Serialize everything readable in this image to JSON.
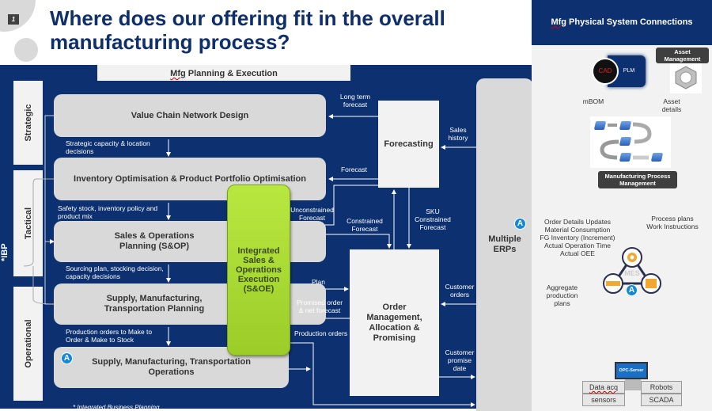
{
  "slide": {
    "number": "1",
    "title": "Where does our offering fit in the overall manufacturing process?"
  },
  "planning_panel": {
    "header_prefix": "Mfg",
    "header_rest": " Planning & Execution",
    "levels": {
      "strategic": "Strategic",
      "tactical": "Tactical",
      "operational": "Operational"
    },
    "ibp_label": "*IBP",
    "boxes": {
      "value_chain": "Value Chain Network Design",
      "inventory": "Inventory Optimisation & Product Portfolio Optimisation",
      "sop": "Sales & Operations Planning (S&OP)",
      "smt_planning": "Supply, Manufacturing, Transportation Planning",
      "smt_operations": "Supply, Manufacturing, Transportation Operations",
      "soe": "Integrated Sales & Operations Execution (S&OE)",
      "forecasting": "Forecasting",
      "order_mgmt": "Order Management, Allocation & Promising",
      "erps": "Multiple ERPs"
    },
    "badge_letter": "A",
    "flow_labels": {
      "strategic_capacity": "Strategic capacity & location decisions",
      "safety_stock": "Safety stock, inventory policy and product mix",
      "sourcing_plan": "Sourcing plan, stocking decision, capacity decisions",
      "production_orders_mto": "Production orders to Make to Order & Make to Stock",
      "long_term_forecast": "Long term forecast",
      "forecast": "Forecast",
      "sales_history": "Sales history",
      "unconstrained_forecast": "Unconstrained Forecast",
      "constrained_forecast": "Constrained Forecast",
      "sku_constrained_forecast": "SKU Constrained Forecast",
      "plan": "Plan",
      "promised_order": "Promised order & net forecast",
      "production_orders": "Production orders",
      "customer_orders": "Customer orders",
      "customer_promise_date": "Customer promise date"
    },
    "footnote": "* Integrated Business Planning"
  },
  "physical_panel": {
    "header_prefix": "Mfg",
    "header_rest": " Physical System Connections",
    "cad": "CAD",
    "plm": "PLM",
    "asset_management": "Asset Management",
    "mbom": "mBOM",
    "asset_details": "Asset details",
    "mpm": "Manufacturing Process Management",
    "erp_updates": [
      "Order Details Updates",
      "Material Consumption",
      "FG Inventory (Increment)",
      "Actual Operation Time",
      "Actual OEE"
    ],
    "process_plans": [
      "Process plans",
      "Work Instructions"
    ],
    "aggregate_plans": "Aggregate production plans",
    "mes": "MES",
    "opc_server": "OPC-Server",
    "data_acq": "Data acq",
    "sensors": "sensors",
    "robots": "Robots",
    "scada": "SCADA"
  },
  "colors": {
    "navy": "#0d3170",
    "soe_green": "#aedc34",
    "badge_blue": "#1488d8",
    "box_grey": "#d9d9d9"
  }
}
